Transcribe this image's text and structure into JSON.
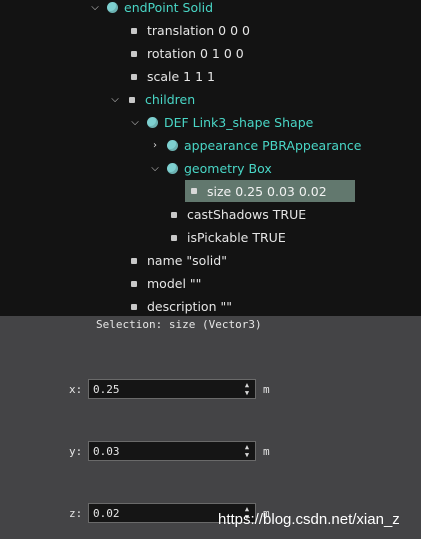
{
  "tree": {
    "endpoint": "endPoint Solid",
    "translation": "translation 0 0 0",
    "rotation": "rotation 0 1 0 0",
    "scale": "scale 1 1 1",
    "children": "children",
    "shape": "DEF Link3_shape Shape",
    "appearance": "appearance PBRAppearance",
    "geometry": "geometry Box",
    "size": "size 0.25 0.03 0.02",
    "castShadows": "castShadows TRUE",
    "isPickable": "isPickable TRUE",
    "name": "name \"solid\"",
    "model": "model \"\"",
    "description": "description \"\""
  },
  "panel": {
    "selection_title": "Selection: size (Vector3)",
    "fields": [
      {
        "label": "x:",
        "value": "0.25",
        "unit": "m"
      },
      {
        "label": "y:",
        "value": "0.03",
        "unit": "m"
      },
      {
        "label": "z:",
        "value": "0.02",
        "unit": "m"
      }
    ]
  },
  "watermark": "https://blog.csdn.net/xian_z",
  "colors": {
    "tree_background": "#131313",
    "panel_background": "#444446",
    "node_accent": "#49d6c6",
    "selection": "#62786e"
  }
}
